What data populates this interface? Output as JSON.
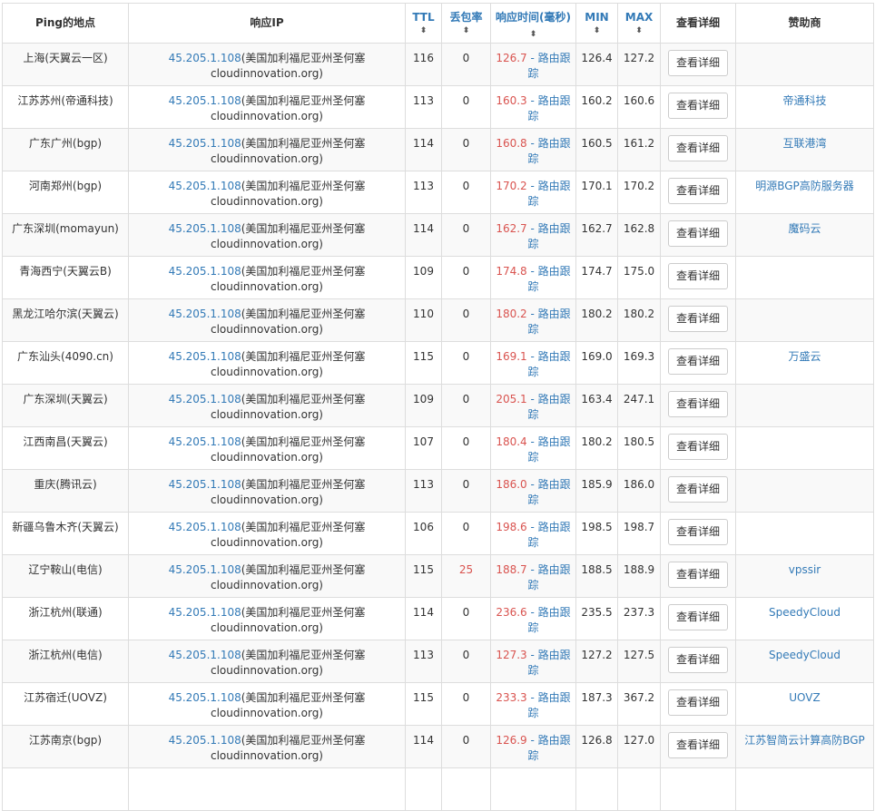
{
  "headers": {
    "location": "Ping的地点",
    "ip": "响应IP",
    "ttl": "TTL",
    "loss": "丢包率",
    "resp": "响应时间(毫秒)",
    "min": "MIN",
    "max": "MAX",
    "detail": "查看详细",
    "sponsor": "赞助商",
    "sort_icon": "sort-updown-icon",
    "sort_glyph": "⬍"
  },
  "colors": {
    "link": "#337ab7",
    "alert": "#d9534f",
    "border": "#dddddd",
    "stripe": "#f9f9f9"
  },
  "rows": [
    {
      "location": "上海(天翼云一区)",
      "ip": "45.205.1.108",
      "geo": "(美国加利福尼亚州圣何塞",
      "geo2": "cloudinnovation.org)",
      "ttl": "116",
      "loss": "0",
      "resp": "126.7",
      "trace_a": "- 路由跟",
      "trace_b": "踪",
      "min": "126.4",
      "max": "127.2",
      "detail": "查看详细",
      "sponsor": ""
    },
    {
      "location": "江苏苏州(帝通科技)",
      "ip": "45.205.1.108",
      "geo": "(美国加利福尼亚州圣何塞",
      "geo2": "cloudinnovation.org)",
      "ttl": "113",
      "loss": "0",
      "resp": "160.3",
      "trace_a": "- 路由跟",
      "trace_b": "踪",
      "min": "160.2",
      "max": "160.6",
      "detail": "查看详细",
      "sponsor": "帝通科技"
    },
    {
      "location": "广东广州(bgp)",
      "ip": "45.205.1.108",
      "geo": "(美国加利福尼亚州圣何塞",
      "geo2": "cloudinnovation.org)",
      "ttl": "114",
      "loss": "0",
      "resp": "160.8",
      "trace_a": "- 路由跟",
      "trace_b": "踪",
      "min": "160.5",
      "max": "161.2",
      "detail": "查看详细",
      "sponsor": "互联港湾"
    },
    {
      "location": "河南郑州(bgp)",
      "ip": "45.205.1.108",
      "geo": "(美国加利福尼亚州圣何塞",
      "geo2": "cloudinnovation.org)",
      "ttl": "113",
      "loss": "0",
      "resp": "170.2",
      "trace_a": "- 路由跟",
      "trace_b": "踪",
      "min": "170.1",
      "max": "170.2",
      "detail": "查看详细",
      "sponsor": "明源BGP高防服务器"
    },
    {
      "location": "广东深圳(momayun)",
      "ip": "45.205.1.108",
      "geo": "(美国加利福尼亚州圣何塞",
      "geo2": "cloudinnovation.org)",
      "ttl": "114",
      "loss": "0",
      "resp": "162.7",
      "trace_a": "- 路由跟",
      "trace_b": "踪",
      "min": "162.7",
      "max": "162.8",
      "detail": "查看详细",
      "sponsor": "魔码云"
    },
    {
      "location": "青海西宁(天翼云B)",
      "ip": "45.205.1.108",
      "geo": "(美国加利福尼亚州圣何塞",
      "geo2": "cloudinnovation.org)",
      "ttl": "109",
      "loss": "0",
      "resp": "174.8",
      "trace_a": "- 路由跟",
      "trace_b": "踪",
      "min": "174.7",
      "max": "175.0",
      "detail": "查看详细",
      "sponsor": ""
    },
    {
      "location": "黑龙江哈尔滨(天翼云)",
      "ip": "45.205.1.108",
      "geo": "(美国加利福尼亚州圣何塞",
      "geo2": "cloudinnovation.org)",
      "ttl": "110",
      "loss": "0",
      "resp": "180.2",
      "trace_a": "- 路由跟",
      "trace_b": "踪",
      "min": "180.2",
      "max": "180.2",
      "detail": "查看详细",
      "sponsor": ""
    },
    {
      "location": "广东汕头(4090.cn)",
      "ip": "45.205.1.108",
      "geo": "(美国加利福尼亚州圣何塞",
      "geo2": "cloudinnovation.org)",
      "ttl": "115",
      "loss": "0",
      "resp": "169.1",
      "trace_a": "- 路由跟",
      "trace_b": "踪",
      "min": "169.0",
      "max": "169.3",
      "detail": "查看详细",
      "sponsor": "万盛云"
    },
    {
      "location": "广东深圳(天翼云)",
      "ip": "45.205.1.108",
      "geo": "(美国加利福尼亚州圣何塞",
      "geo2": "cloudinnovation.org)",
      "ttl": "109",
      "loss": "0",
      "resp": "205.1",
      "trace_a": "- 路由跟",
      "trace_b": "踪",
      "min": "163.4",
      "max": "247.1",
      "detail": "查看详细",
      "sponsor": ""
    },
    {
      "location": "江西南昌(天翼云)",
      "ip": "45.205.1.108",
      "geo": "(美国加利福尼亚州圣何塞",
      "geo2": "cloudinnovation.org)",
      "ttl": "107",
      "loss": "0",
      "resp": "180.4",
      "trace_a": "- 路由跟",
      "trace_b": "踪",
      "min": "180.2",
      "max": "180.5",
      "detail": "查看详细",
      "sponsor": ""
    },
    {
      "location": "重庆(腾讯云)",
      "ip": "45.205.1.108",
      "geo": "(美国加利福尼亚州圣何塞",
      "geo2": "cloudinnovation.org)",
      "ttl": "113",
      "loss": "0",
      "resp": "186.0",
      "trace_a": "- 路由跟",
      "trace_b": "踪",
      "min": "185.9",
      "max": "186.0",
      "detail": "查看详细",
      "sponsor": ""
    },
    {
      "location": "新疆乌鲁木齐(天翼云)",
      "ip": "45.205.1.108",
      "geo": "(美国加利福尼亚州圣何塞",
      "geo2": "cloudinnovation.org)",
      "ttl": "106",
      "loss": "0",
      "resp": "198.6",
      "trace_a": "- 路由跟",
      "trace_b": "踪",
      "min": "198.5",
      "max": "198.7",
      "detail": "查看详细",
      "sponsor": ""
    },
    {
      "location": "辽宁鞍山(电信)",
      "ip": "45.205.1.108",
      "geo": "(美国加利福尼亚州圣何塞",
      "geo2": "cloudinnovation.org)",
      "ttl": "115",
      "loss": "25",
      "resp": "188.7",
      "trace_a": "- 路由跟",
      "trace_b": "踪",
      "min": "188.5",
      "max": "188.9",
      "detail": "查看详细",
      "sponsor": "vpssir"
    },
    {
      "location": "浙江杭州(联通)",
      "ip": "45.205.1.108",
      "geo": "(美国加利福尼亚州圣何塞",
      "geo2": "cloudinnovation.org)",
      "ttl": "114",
      "loss": "0",
      "resp": "236.6",
      "trace_a": "- 路由跟",
      "trace_b": "踪",
      "min": "235.5",
      "max": "237.3",
      "detail": "查看详细",
      "sponsor": "SpeedyCloud"
    },
    {
      "location": "浙江杭州(电信)",
      "ip": "45.205.1.108",
      "geo": "(美国加利福尼亚州圣何塞",
      "geo2": "cloudinnovation.org)",
      "ttl": "113",
      "loss": "0",
      "resp": "127.3",
      "trace_a": "- 路由跟",
      "trace_b": "踪",
      "min": "127.2",
      "max": "127.5",
      "detail": "查看详细",
      "sponsor": "SpeedyCloud"
    },
    {
      "location": "江苏宿迁(UOVZ)",
      "ip": "45.205.1.108",
      "geo": "(美国加利福尼亚州圣何塞",
      "geo2": "cloudinnovation.org)",
      "ttl": "115",
      "loss": "0",
      "resp": "233.3",
      "trace_a": "- 路由跟",
      "trace_b": "踪",
      "min": "187.3",
      "max": "367.2",
      "detail": "查看详细",
      "sponsor": "UOVZ"
    },
    {
      "location": "江苏南京(bgp)",
      "ip": "45.205.1.108",
      "geo": "(美国加利福尼亚州圣何塞",
      "geo2": "cloudinnovation.org)",
      "ttl": "114",
      "loss": "0",
      "resp": "126.9",
      "trace_a": "- 路由跟",
      "trace_b": "踪",
      "min": "126.8",
      "max": "127.0",
      "detail": "查看详细",
      "sponsor": "江苏智简云计算高防BGP"
    },
    {
      "location": "",
      "ip": "",
      "geo": "",
      "geo2": "",
      "ttl": "",
      "loss": "",
      "resp": "",
      "trace_a": "",
      "trace_b": "",
      "min": "",
      "max": "",
      "detail": "",
      "sponsor": ""
    }
  ]
}
